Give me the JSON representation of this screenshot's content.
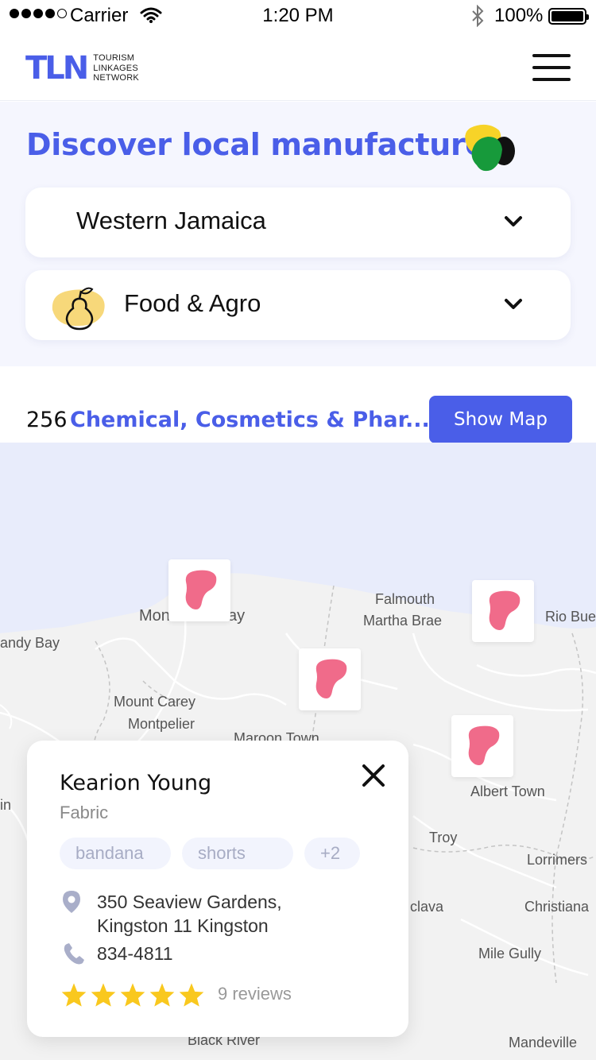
{
  "status_bar": {
    "carrier": "Carrier",
    "time": "1:20 PM",
    "battery_pct": "100%"
  },
  "header": {
    "logo_mark": "TLN",
    "logo_text": [
      "TOURISM",
      "LINKAGES",
      "NETWORK"
    ]
  },
  "discover": {
    "title": "Discover local manufactures",
    "region_select": "Western Jamaica",
    "category_select": "Food & Agro"
  },
  "results": {
    "count": "256",
    "category": "Chemical, Cosmetics & Phar...",
    "show_map_label": "Show Map"
  },
  "map": {
    "places": [
      "Falmouth",
      "Martha Brae",
      "Rio Bue",
      "andy Bay",
      "Mont",
      "ay",
      "Mount Carey",
      "Montpelier",
      "Maroon Town",
      "Albert Town",
      "Troy",
      "Lorrimers",
      "clava",
      "Christiana",
      "Mile Gully",
      "Black River",
      "Mandeville",
      "in"
    ],
    "pin_color": "#f06b8a",
    "water_color": "#e8ecfb"
  },
  "card": {
    "name": "Kearion Young",
    "type": "Fabric",
    "tags": [
      "bandana",
      "shorts",
      "+2"
    ],
    "address_line1": "350 Seaview Gardens,",
    "address_line2": "Kingston 11 Kingston",
    "phone": "834-4811",
    "rating": 5,
    "reviews": "9 reviews"
  },
  "colors": {
    "accent": "#4a5ee8",
    "star": "#f9c81e"
  }
}
